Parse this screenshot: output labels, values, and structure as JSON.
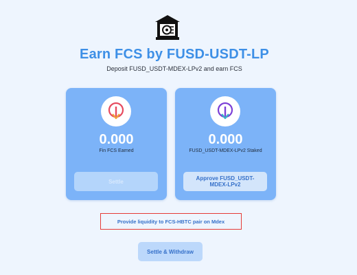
{
  "header": {
    "icon": "bank-vault-icon",
    "title": "Earn FCS by FUSD-USDT-LP",
    "subtitle": "Deposit FUSD_USDT-MDEX-LPv2 and earn FCS"
  },
  "cards": {
    "earned": {
      "icon": "token-down-arrow-icon",
      "value": "0.000",
      "label": "Fin FCS Earned",
      "button_label": "Settle",
      "button_enabled": false
    },
    "staked": {
      "icon": "token-down-arrow-icon",
      "value": "0.000",
      "label": "FUSD_USDT-MDEX-LPv2 Staked",
      "button_label": "Approve FUSD_USDT-MDEX-LPv2",
      "button_enabled": true
    }
  },
  "liquidity_link": {
    "label": "Provide liquidity to FCS-HBTC pair on Mdex"
  },
  "footer": {
    "settle_withdraw_label": "Settle & Withdraw"
  },
  "colors": {
    "page_background": "#eef5fe",
    "accent": "#3d8fe6",
    "card_background": "#7cb3f8",
    "link_outline": "#e53935",
    "earned_icon": "#e64a5e",
    "staked_icon": "#7b3fd6"
  }
}
